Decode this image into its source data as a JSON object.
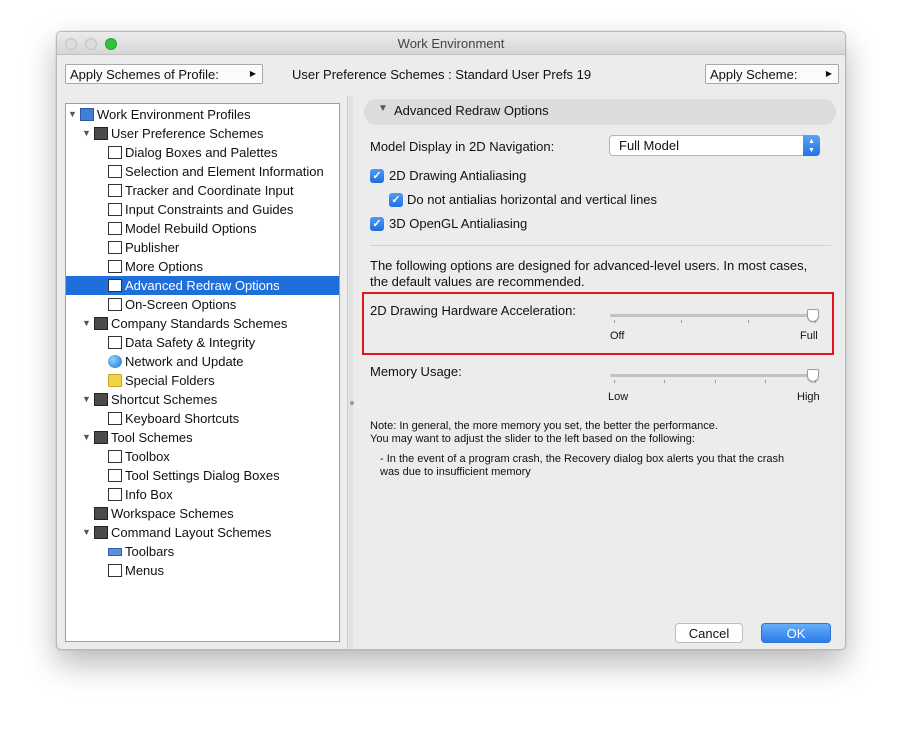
{
  "window": {
    "title": "Work Environment"
  },
  "topbar": {
    "profile_popup": "Apply Schemes of Profile:",
    "center_label": "User Preference Schemes : Standard User Prefs 19",
    "scheme_popup": "Apply Scheme:"
  },
  "tree": {
    "items": [
      {
        "label": "Work Environment Profiles",
        "level": 0,
        "expanded": true,
        "icon": "profiles-icon"
      },
      {
        "label": "User Preference Schemes",
        "level": 1,
        "expanded": true,
        "icon": "user-scheme-icon"
      },
      {
        "label": "Dialog Boxes and Palettes",
        "level": 2,
        "icon": "dialog-icon"
      },
      {
        "label": "Selection and Element Information",
        "level": 2,
        "icon": "selection-icon"
      },
      {
        "label": "Tracker and Coordinate Input",
        "level": 2,
        "icon": "tracker-icon"
      },
      {
        "label": "Input Constraints and Guides",
        "level": 2,
        "icon": "constraints-icon"
      },
      {
        "label": "Model Rebuild Options",
        "level": 2,
        "icon": "rebuild-icon"
      },
      {
        "label": "Publisher",
        "level": 2,
        "icon": "publisher-icon"
      },
      {
        "label": "More Options",
        "level": 2,
        "icon": "options-icon"
      },
      {
        "label": "Advanced Redraw Options",
        "level": 2,
        "icon": "redraw-icon",
        "selected": true
      },
      {
        "label": "On-Screen Options",
        "level": 2,
        "icon": "screen-icon"
      },
      {
        "label": "Company Standards Schemes",
        "level": 1,
        "expanded": true,
        "icon": "company-icon"
      },
      {
        "label": "Data Safety & Integrity",
        "level": 2,
        "icon": "safety-icon"
      },
      {
        "label": "Network and Update",
        "level": 2,
        "icon": "globe-icon"
      },
      {
        "label": "Special Folders",
        "level": 2,
        "icon": "folder-icon"
      },
      {
        "label": "Shortcut Schemes",
        "level": 1,
        "expanded": true,
        "icon": "shortcut-scheme-icon"
      },
      {
        "label": "Keyboard Shortcuts",
        "level": 2,
        "icon": "keyboard-icon"
      },
      {
        "label": "Tool Schemes",
        "level": 1,
        "expanded": true,
        "icon": "tool-scheme-icon"
      },
      {
        "label": "Toolbox",
        "level": 2,
        "icon": "toolbox-icon"
      },
      {
        "label": "Tool Settings Dialog Boxes",
        "level": 2,
        "icon": "tool-settings-icon"
      },
      {
        "label": "Info Box",
        "level": 2,
        "icon": "info-box-icon"
      },
      {
        "label": "Workspace Schemes",
        "level": 1,
        "expanded": false,
        "icon": "workspace-icon"
      },
      {
        "label": "Command Layout Schemes",
        "level": 1,
        "expanded": true,
        "icon": "command-layout-icon"
      },
      {
        "label": "Toolbars",
        "level": 2,
        "icon": "toolbars-icon"
      },
      {
        "label": "Menus",
        "level": 2,
        "icon": "menus-icon"
      }
    ]
  },
  "panel": {
    "section_title": "Advanced Redraw Options",
    "model_display_label": "Model Display in 2D Navigation:",
    "model_display_value": "Full Model",
    "cb_2d_aa": "2D Drawing Antialiasing",
    "cb_no_hv": "Do not antialias horizontal and vertical lines",
    "cb_3d_aa": "3D OpenGL Antialiasing",
    "info_line1": "The following options are designed for advanced-level users. In most cases,",
    "info_line2": "the default values are recommended.",
    "hw_label": "2D Drawing Hardware Acceleration:",
    "hw_min": "Off",
    "hw_max": "Full",
    "hw_value": 1.0,
    "mem_label": "Memory Usage:",
    "mem_min": "Low",
    "mem_max": "High",
    "mem_value": 1.0,
    "note1": "Note: In general, the more memory you set, the better the performance.",
    "note2": "You may want to adjust the slider to the left based on the following:",
    "note3": "- In the event of a program crash, the Recovery dialog box alerts you that the crash",
    "note4": "was due to insufficient memory"
  },
  "buttons": {
    "cancel": "Cancel",
    "ok": "OK"
  },
  "colors": {
    "accent": "#1e6fd9",
    "highlight_box": "#e0141c"
  }
}
